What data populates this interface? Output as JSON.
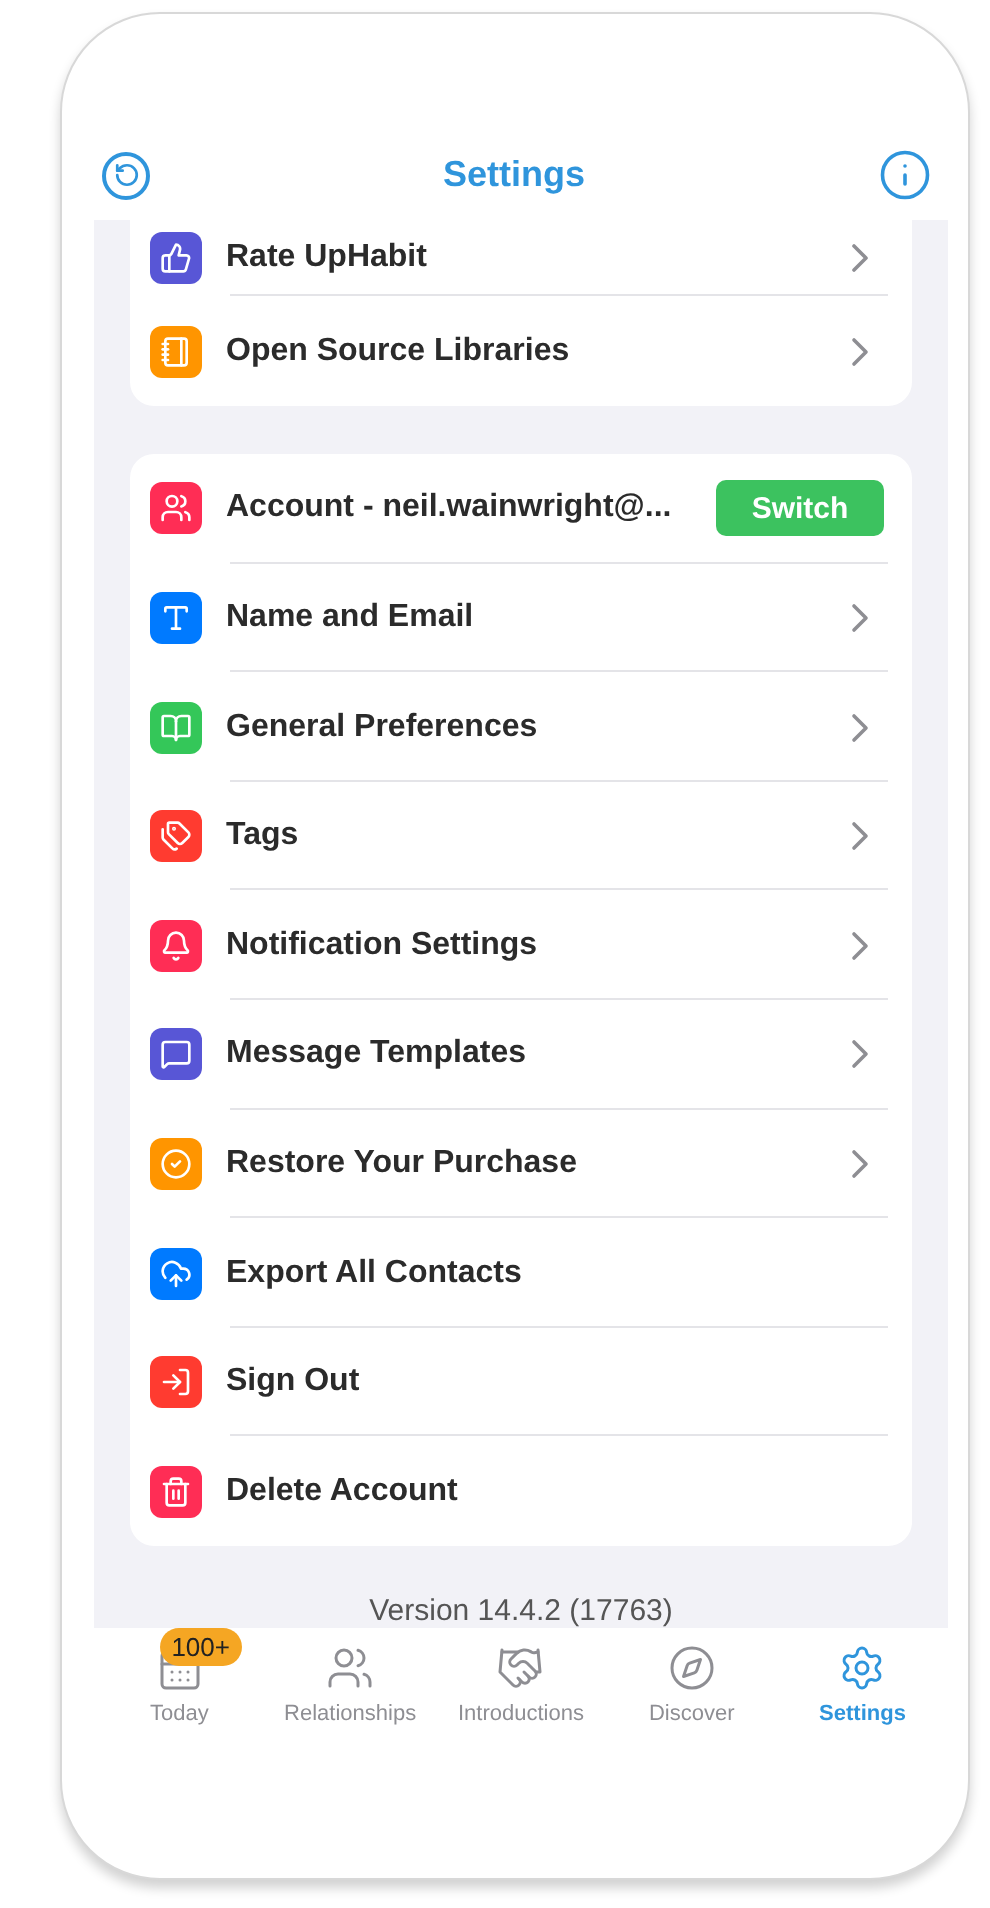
{
  "header": {
    "title": "Settings"
  },
  "sections": [
    {
      "items": [
        {
          "label": "Rate UpHabit",
          "kind": "chevron",
          "color": "#5856d6"
        },
        {
          "label": "Open Source Libraries",
          "kind": "chevron",
          "color": "#ff9500"
        }
      ]
    },
    {
      "items": [
        {
          "label": "Account - neil.wainwright@...",
          "kind": "button",
          "button": "Switch",
          "color": "#ff2d55"
        },
        {
          "label": "Name and Email",
          "kind": "chevron",
          "color": "#007aff"
        },
        {
          "label": "General Preferences",
          "kind": "chevron",
          "color": "#34c759"
        },
        {
          "label": "Tags",
          "kind": "chevron",
          "color": "#ff3b30"
        },
        {
          "label": "Notification Settings",
          "kind": "chevron",
          "color": "#ff2d55"
        },
        {
          "label": "Message Templates",
          "kind": "chevron",
          "color": "#5856d6"
        },
        {
          "label": "Restore Your Purchase",
          "kind": "chevron",
          "color": "#ff9500"
        },
        {
          "label": "Export All Contacts",
          "kind": "plain",
          "color": "#007aff"
        },
        {
          "label": "Sign Out",
          "kind": "plain",
          "color": "#ff3b30"
        },
        {
          "label": "Delete Account",
          "kind": "plain",
          "color": "#ff2d55"
        }
      ]
    }
  ],
  "version": "Version 14.4.2 (17763)",
  "tabs": [
    {
      "label": "Today",
      "badge": "100+",
      "selected": false
    },
    {
      "label": "Relationships",
      "selected": false
    },
    {
      "label": "Introductions",
      "selected": false
    },
    {
      "label": "Discover",
      "selected": false
    },
    {
      "label": "Settings",
      "selected": true
    }
  ]
}
